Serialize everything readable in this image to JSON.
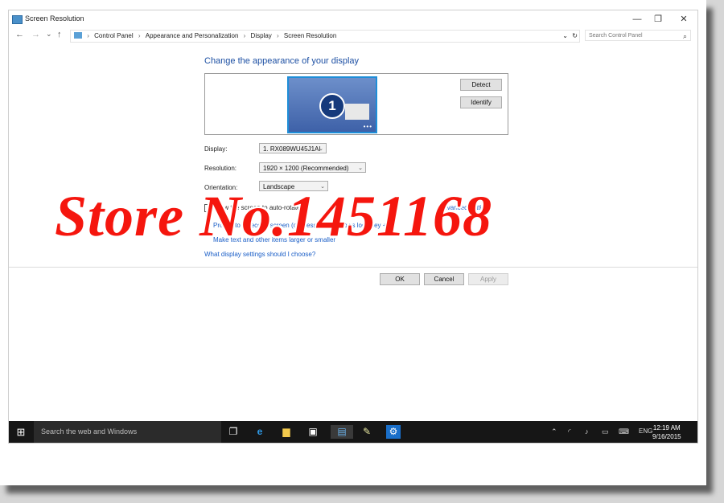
{
  "window": {
    "title": "Screen Resolution",
    "min_glyph": "—",
    "restore_glyph": "❐",
    "close_glyph": "✕"
  },
  "address_bar": {
    "back_glyph": "←",
    "forward_glyph": "→",
    "recent_glyph": "⌄",
    "up_glyph": "↑",
    "breadcrumbs": [
      "Control Panel",
      "Appearance and Personalization",
      "Display",
      "Screen Resolution"
    ],
    "dropdown_glyph": "⌄",
    "refresh_glyph": "↻",
    "search_placeholder": "Search Control Panel"
  },
  "content": {
    "heading": "Change the appearance of your display",
    "monitor_number": "1",
    "detect_label": "Detect",
    "identify_label": "Identify",
    "display_label": "Display:",
    "display_value": "1. RX089WU45J1AI",
    "resolution_label": "Resolution:",
    "resolution_value": "1920 × 1200 (Recommended)",
    "orientation_label": "Orientation:",
    "orientation_value": "Landscape",
    "autorotate_checked": true,
    "autorotate_text": "Allow the screen to auto-rotate",
    "advanced_link": "Advanced settings",
    "project_text": "Project to a second screen (or press the Windows logo key + P)",
    "text_size_link": "Make text and other items larger or smaller",
    "help_link": "What display settings should I choose?",
    "ok_label": "OK",
    "cancel_label": "Cancel",
    "apply_label": "Apply"
  },
  "taskbar": {
    "search_placeholder": "Search the web and Windows",
    "language": "ENG",
    "time": "12:19 AM",
    "date": "9/16/2015"
  },
  "watermark": "Store No.1451168",
  "colors": {
    "heading": "#1c4fa3",
    "link": "#1a5ec7",
    "taskbar": "#161616",
    "watermark": "#f5160e",
    "monitor_border": "#1e8ed8"
  }
}
